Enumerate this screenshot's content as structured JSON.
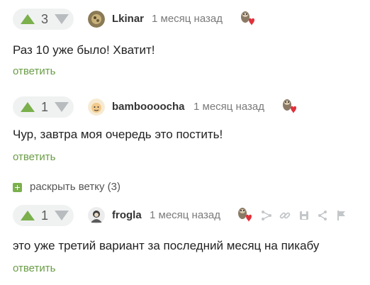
{
  "comments": [
    {
      "rating": "3",
      "author": "Lkinar",
      "time": "1 месяц назад",
      "text": "Раз 10 уже было! Хватит!",
      "reply_label": "ответить"
    },
    {
      "rating": "1",
      "author": "bamboooocha",
      "time": "1 месяц назад",
      "text": "Чур, завтра моя очередь это постить!",
      "reply_label": "ответить"
    },
    {
      "rating": "1",
      "author": "frogla",
      "time": "1 месяц назад",
      "text": "это уже третий вариант за последний месяц на пикабу",
      "reply_label": "ответить"
    }
  ],
  "expand_thread": {
    "label": "раскрыть ветку (3)"
  },
  "toolbar_icons": [
    "tree-icon",
    "link-icon",
    "save-icon",
    "share-icon",
    "flag-icon"
  ],
  "colors": {
    "accent_green": "#7bb04c",
    "reply_green": "#6a9c45",
    "vote_down_gray": "#b8bcbf",
    "pill_bg": "#f0f2f2"
  }
}
